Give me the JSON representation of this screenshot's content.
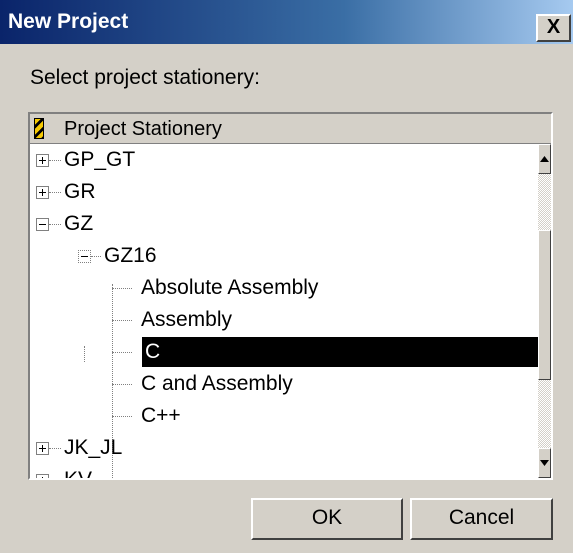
{
  "window": {
    "title": "New Project",
    "close_glyph": "X"
  },
  "prompt": "Select project stationery:",
  "tree": {
    "header_label": "Project Stationery",
    "header_icon": "stationery-icon",
    "rows": [
      {
        "label": "GP_GT",
        "level": 0,
        "expander": "plus"
      },
      {
        "label": "GR",
        "level": 0,
        "expander": "plus"
      },
      {
        "label": "GZ",
        "level": 0,
        "expander": "minus"
      },
      {
        "label": "GZ16",
        "level": 1,
        "expander": "minus"
      },
      {
        "label": "Absolute Assembly",
        "level": 2
      },
      {
        "label": "Assembly",
        "level": 2
      },
      {
        "label": "C",
        "level": 2,
        "selected": true
      },
      {
        "label": "C and  Assembly",
        "level": 2
      },
      {
        "label": "C++",
        "level": 2
      },
      {
        "label": "JK_JL",
        "level": 0,
        "expander": "plus"
      },
      {
        "label": "KV",
        "level": 0,
        "expander": "plus",
        "partial": true
      }
    ],
    "scroll_up_icon": "arrow-up-icon",
    "scroll_down_icon": "arrow-down-icon"
  },
  "buttons": {
    "ok": "OK",
    "cancel": "Cancel"
  },
  "colors": {
    "title_gradient_start": "#0a246a",
    "title_gradient_end": "#a6caf0",
    "dialog_bg": "#d4d0c8",
    "selection_bg": "#000000",
    "selection_text": "#ffffff"
  }
}
